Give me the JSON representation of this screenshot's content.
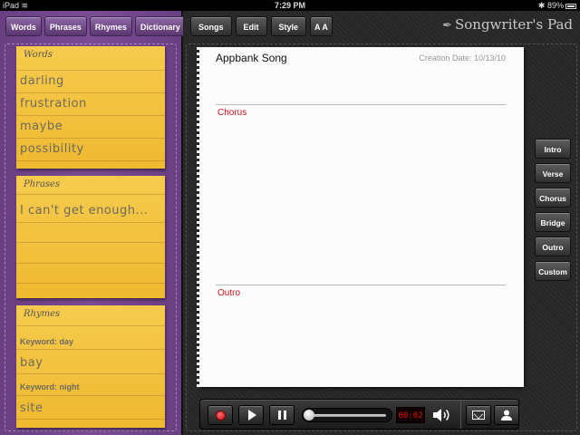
{
  "status_bar": {
    "device": "iPad",
    "time": "7:29 PM",
    "battery": "89%"
  },
  "sidebar": {
    "tabs": [
      {
        "label": "Words"
      },
      {
        "label": "Phrases"
      },
      {
        "label": "Rhymes"
      },
      {
        "label": "Dictionary"
      }
    ],
    "words_note": {
      "title": "Words",
      "items": [
        "darling",
        "frustration",
        "maybe",
        "possibility"
      ]
    },
    "phrases_note": {
      "title": "Phrases",
      "items": [
        "I can't get enough..."
      ]
    },
    "rhymes_note": {
      "title": "Rhymes",
      "entries": [
        {
          "keyword": "Keyword: day",
          "rhyme": "bay"
        },
        {
          "keyword": "Keyword: night",
          "rhyme": "site"
        }
      ]
    }
  },
  "toolbar": {
    "buttons": [
      {
        "label": "Songs"
      },
      {
        "label": "Edit"
      },
      {
        "label": "Style"
      },
      {
        "label": "A A"
      }
    ],
    "app_name": "Songwriter's Pad"
  },
  "song": {
    "title": "Appbank Song",
    "creation_date": "Creation Date: 10/13/10",
    "sections": [
      "Chorus",
      "Outro"
    ]
  },
  "section_buttons": [
    {
      "label": "Intro"
    },
    {
      "label": "Verse"
    },
    {
      "label": "Chorus"
    },
    {
      "label": "Bridge"
    },
    {
      "label": "Outro"
    },
    {
      "label": "Custom"
    }
  ],
  "transport": {
    "timer": "00:02",
    "playback_position": 0.0,
    "icons": [
      "record-icon",
      "play-icon",
      "pause-icon",
      "volume-icon",
      "mail-icon",
      "contact-icon"
    ]
  },
  "colors": {
    "sidebar": "#7b4c93",
    "note": "#f2c13c",
    "section_label": "#c8151b",
    "timer": "#e01515"
  }
}
